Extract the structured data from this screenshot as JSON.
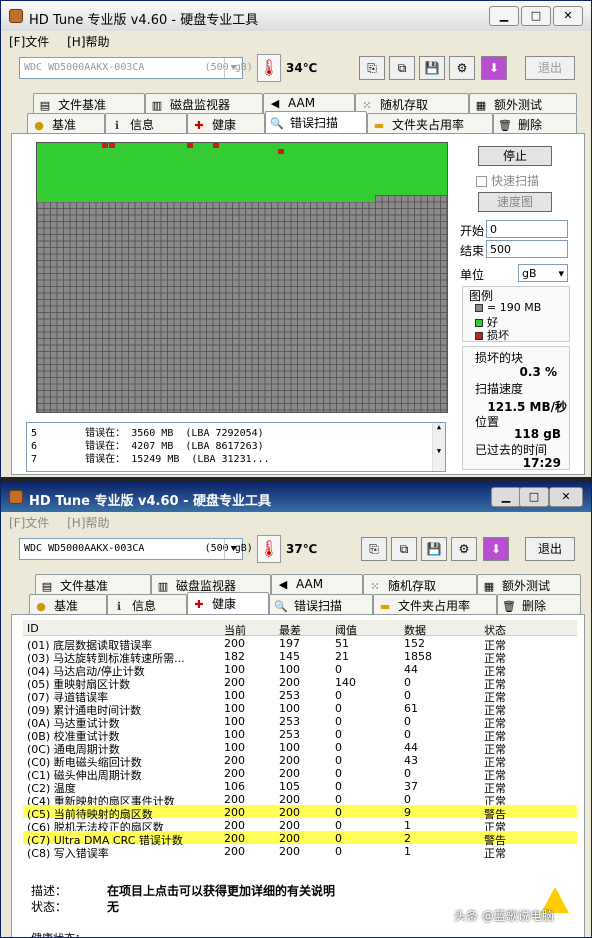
{
  "w1": {
    "title": "HD Tune 专业版 v4.60 - 硬盘专业工具",
    "menu": [
      "[F]文件",
      "[H]帮助"
    ],
    "drive": "WDC WD5000AAKX-003CA          (500 gB)",
    "temp": "34℃",
    "exit": "退出",
    "tabs_top": [
      "文件基准",
      "磁盘监视器",
      "AAM",
      "随机存取",
      "额外测试"
    ],
    "tabs_bottom": [
      "基准",
      "信息",
      "健康",
      "错误扫描",
      "文件夹占用率",
      "删除"
    ],
    "stop": "停止",
    "quick": "快速扫描",
    "speedmap": "速度图",
    "start_label": "开始",
    "start_val": "0",
    "end_label": "结束",
    "end_val": "500",
    "unit_label": "单位",
    "unit_val": "gB",
    "legend_title": "图例",
    "legend": [
      "= 190 MB",
      "好",
      "损坏"
    ],
    "damaged_label": "损坏的块",
    "damaged_val": "0.3 %",
    "speed_label": "扫描速度",
    "speed_val": "121.5 MB/秒",
    "pos_label": "位置",
    "pos_val": "118 gB",
    "elapsed_label": "已过去的时间",
    "elapsed_val": "17:29",
    "log": [
      "5        错误在： 3560 MB  (LBA 7292054)",
      "6        错误在： 4207 MB  (LBA 8617263)",
      "7        错误在： 15249 MB  (LBA 31231..."
    ]
  },
  "w2": {
    "title": "HD Tune 专业版 v4.60 - 硬盘专业工具",
    "menu": [
      "[F]文件",
      "[H]帮助"
    ],
    "drive": "WDC WD5000AAKX-003CA          (500 gB)",
    "temp": "37℃",
    "exit": "退出",
    "tabs_top": [
      "文件基准",
      "磁盘监视器",
      "AAM",
      "随机存取",
      "额外测试"
    ],
    "tabs_bottom": [
      "基准",
      "信息",
      "健康",
      "错误扫描",
      "文件夹占用率",
      "删除"
    ],
    "headers": [
      "ID",
      "当前",
      "最差",
      "阈值",
      "数据",
      "状态"
    ],
    "rows": [
      [
        "(01) 底层数据读取错误率",
        "200",
        "197",
        "51",
        "152",
        "正常"
      ],
      [
        "(03) 马达旋转到标准转速所需...",
        "182",
        "145",
        "21",
        "1858",
        "正常"
      ],
      [
        "(04) 马达启动/停止计数",
        "100",
        "100",
        "0",
        "44",
        "正常"
      ],
      [
        "(05) 重映射扇区计数",
        "200",
        "200",
        "140",
        "0",
        "正常"
      ],
      [
        "(07) 寻道错误率",
        "100",
        "253",
        "0",
        "0",
        "正常"
      ],
      [
        "(09) 累计通电时间计数",
        "100",
        "100",
        "0",
        "61",
        "正常"
      ],
      [
        "(0A) 马达重试计数",
        "100",
        "253",
        "0",
        "0",
        "正常"
      ],
      [
        "(0B) 校准重试计数",
        "100",
        "253",
        "0",
        "0",
        "正常"
      ],
      [
        "(0C) 通电周期计数",
        "100",
        "100",
        "0",
        "44",
        "正常"
      ],
      [
        "(C0) 断电磁头缩回计数",
        "200",
        "200",
        "0",
        "43",
        "正常"
      ],
      [
        "(C1) 磁头伸出周期计数",
        "200",
        "200",
        "0",
        "0",
        "正常"
      ],
      [
        "(C2) 温度",
        "106",
        "105",
        "0",
        "37",
        "正常"
      ],
      [
        "(C4) 重新映射的扇区事件计数",
        "200",
        "200",
        "0",
        "0",
        "正常"
      ],
      [
        "(C5) 当前待映射的扇区数",
        "200",
        "200",
        "0",
        "9",
        "警告"
      ],
      [
        "(C6) 脱机无法校正的扇区数",
        "200",
        "200",
        "0",
        "1",
        "正常"
      ],
      [
        "(C7) Ultra DMA CRC 错误计数",
        "200",
        "200",
        "0",
        "2",
        "警告"
      ],
      [
        "(C8) 写入错误率",
        "200",
        "200",
        "0",
        "1",
        "正常"
      ]
    ],
    "desc_label": "描述：",
    "desc_val": "在项目上点击可以获得更加详细的有关说明",
    "status_label": "状态：",
    "status_val": "无",
    "health_label": "健康状态："
  },
  "watermark": "头条 @蓝歌说电脑"
}
